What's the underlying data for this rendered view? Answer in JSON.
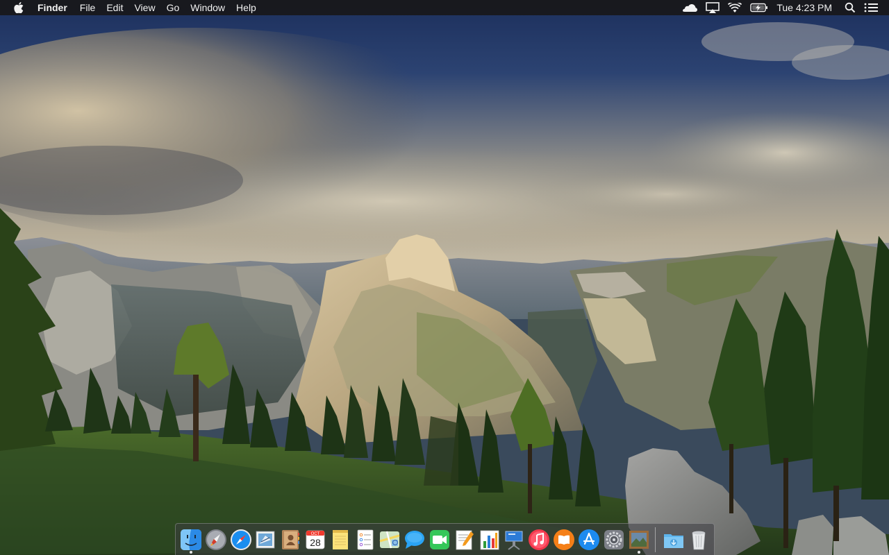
{
  "menubar": {
    "apple_icon": "apple-logo",
    "app_name": "Finder",
    "menus": [
      "File",
      "Edit",
      "View",
      "Go",
      "Window",
      "Help"
    ],
    "status_icons": [
      "cloud-icon",
      "airplay-icon",
      "wifi-icon",
      "battery-charging-icon"
    ],
    "clock": "Tue 4:23 PM",
    "right_icons": [
      "spotlight-search-icon",
      "notification-center-icon"
    ]
  },
  "dock": {
    "apps": [
      {
        "name": "Finder",
        "icon": "finder-icon",
        "running": true
      },
      {
        "name": "Launchpad",
        "icon": "launchpad-icon",
        "running": false
      },
      {
        "name": "Safari",
        "icon": "safari-icon",
        "running": false
      },
      {
        "name": "Mail",
        "icon": "mail-icon",
        "running": false
      },
      {
        "name": "Contacts",
        "icon": "contacts-icon",
        "running": false
      },
      {
        "name": "Calendar",
        "icon": "calendar-icon",
        "running": false,
        "month": "OCT",
        "day": "28"
      },
      {
        "name": "Notes",
        "icon": "notes-icon",
        "running": false
      },
      {
        "name": "Reminders",
        "icon": "reminders-icon",
        "running": false
      },
      {
        "name": "Maps",
        "icon": "maps-icon",
        "running": false
      },
      {
        "name": "Messages",
        "icon": "messages-icon",
        "running": false
      },
      {
        "name": "FaceTime",
        "icon": "facetime-icon",
        "running": false
      },
      {
        "name": "Pages",
        "icon": "pages-icon",
        "running": false
      },
      {
        "name": "Numbers",
        "icon": "numbers-icon",
        "running": false
      },
      {
        "name": "Keynote",
        "icon": "keynote-icon",
        "running": false
      },
      {
        "name": "iTunes",
        "icon": "itunes-icon",
        "running": false
      },
      {
        "name": "iBooks",
        "icon": "ibooks-icon",
        "running": false
      },
      {
        "name": "App Store",
        "icon": "app-store-icon",
        "running": false
      },
      {
        "name": "System Preferences",
        "icon": "system-preferences-icon",
        "running": false
      },
      {
        "name": "Preview",
        "icon": "preview-icon",
        "running": true
      }
    ],
    "stacks": [
      {
        "name": "Downloads",
        "icon": "downloads-folder-icon"
      },
      {
        "name": "Trash",
        "icon": "trash-icon"
      }
    ]
  },
  "colors": {
    "menubar_bg": "#18181a",
    "menubar_text": "#f2f2f2",
    "safari_blue": "#1a8ef0",
    "messages_blue": "#2aa4f4",
    "facetime_green": "#35c759",
    "itunes_red": "#f2384c",
    "ibooks_orange": "#f57f17"
  }
}
